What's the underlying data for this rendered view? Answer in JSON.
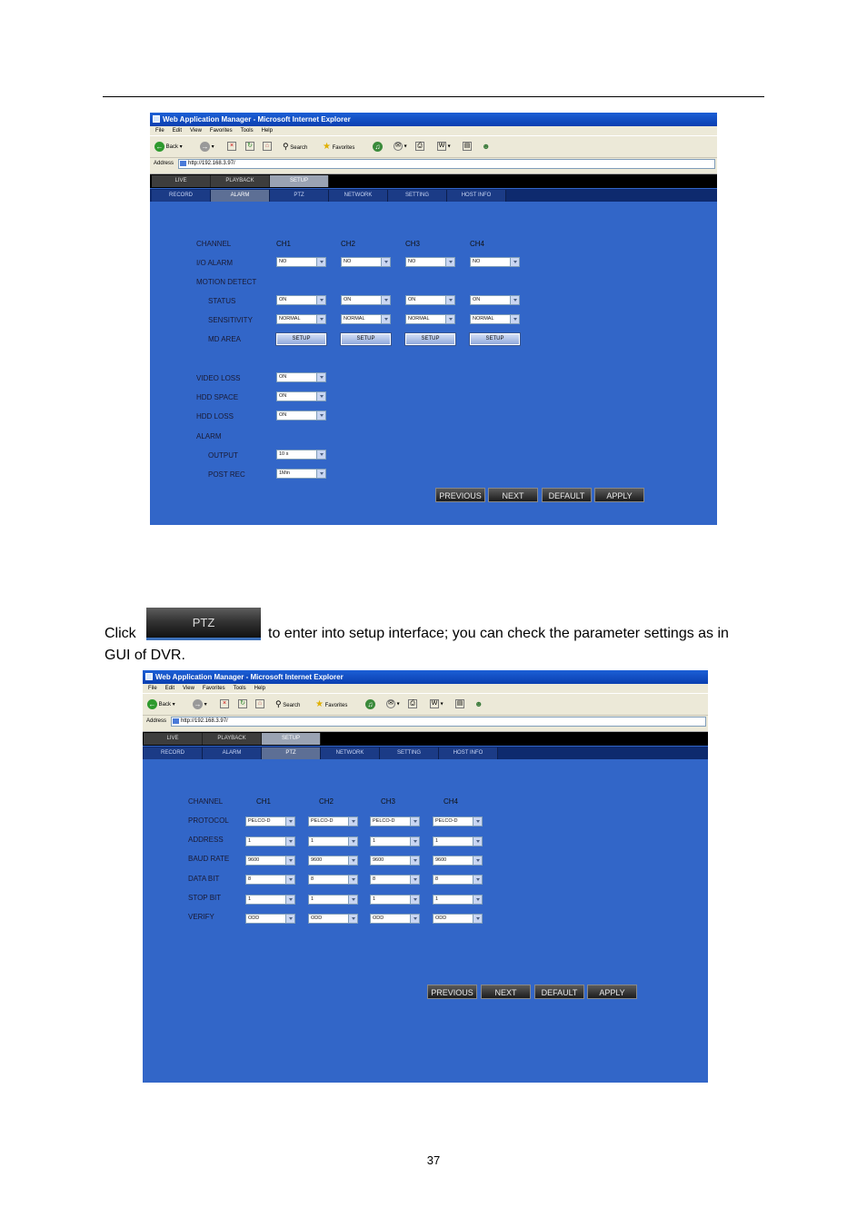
{
  "browser": {
    "title": "Web Application Manager - Microsoft Internet Explorer",
    "menu": [
      "File",
      "Edit",
      "View",
      "Favorites",
      "Tools",
      "Help"
    ],
    "back_label": "Back",
    "search_label": "Search",
    "favorites_label": "Favorites",
    "address_label": "Address",
    "url": "http://192.168.3.97/"
  },
  "nav": {
    "main_tabs": [
      "LIVE",
      "PLAYBACK",
      "SETUP"
    ],
    "sub_tabs": [
      "RECORD",
      "ALARM",
      "PTZ",
      "NETWORK",
      "SETTING",
      "HOST INFO"
    ]
  },
  "alarm_page": {
    "channel_label": "CHANNEL",
    "channels": [
      "CH1",
      "CH2",
      "CH3",
      "CH4"
    ],
    "io_alarm_label": "I/O ALARM",
    "io_alarm_values": [
      "NO",
      "NO",
      "NO",
      "NO"
    ],
    "motion_detect_label": "MOTION DETECT",
    "status_label": "STATUS",
    "status_values": [
      "ON",
      "ON",
      "ON",
      "ON"
    ],
    "sensitivity_label": "SENSITIVITY",
    "sensitivity_values": [
      "NORMAL",
      "NORMAL",
      "NORMAL",
      "NORMAL"
    ],
    "md_area_label": "MD AREA",
    "setup_label": "SETUP",
    "video_loss_label": "VIDEO LOSS",
    "video_loss_value": "ON",
    "hdd_space_label": "HDD SPACE",
    "hdd_space_value": "ON",
    "hdd_loss_label": "HDD LOSS",
    "hdd_loss_value": "ON",
    "alarm_label": "ALARM",
    "output_label": "OUTPUT",
    "output_value": "10 s",
    "post_rec_label": "POST REC",
    "post_rec_value": "1Min"
  },
  "ptz_page": {
    "channel_label": "CHANNEL",
    "channels": [
      "CH1",
      "CH2",
      "CH3",
      "CH4"
    ],
    "rows": [
      {
        "label": "PROTOCOL",
        "values": [
          "PELCO-D",
          "PELCO-D",
          "PELCO-D",
          "PELCO-D"
        ]
      },
      {
        "label": "ADDRESS",
        "values": [
          "1",
          "1",
          "1",
          "1"
        ]
      },
      {
        "label": "BAUD RATE",
        "values": [
          "9600",
          "9600",
          "9600",
          "9600"
        ]
      },
      {
        "label": "DATA BIT",
        "values": [
          "8",
          "8",
          "8",
          "8"
        ]
      },
      {
        "label": "STOP BIT",
        "values": [
          "1",
          "1",
          "1",
          "1"
        ]
      },
      {
        "label": "VERIFY",
        "values": [
          "ODD",
          "ODD",
          "ODD",
          "ODD"
        ]
      }
    ]
  },
  "actions": {
    "previous": "PREVIOUS",
    "next": "NEXT",
    "default": "DEFAULT",
    "apply": "APPLY"
  },
  "doc": {
    "click_text": "Click",
    "ptz_button_label": "PTZ",
    "instruction_text": "to enter into setup interface; you can check the parameter settings as in",
    "instruction_text_2": "GUI of DVR.",
    "page_number": "37"
  }
}
